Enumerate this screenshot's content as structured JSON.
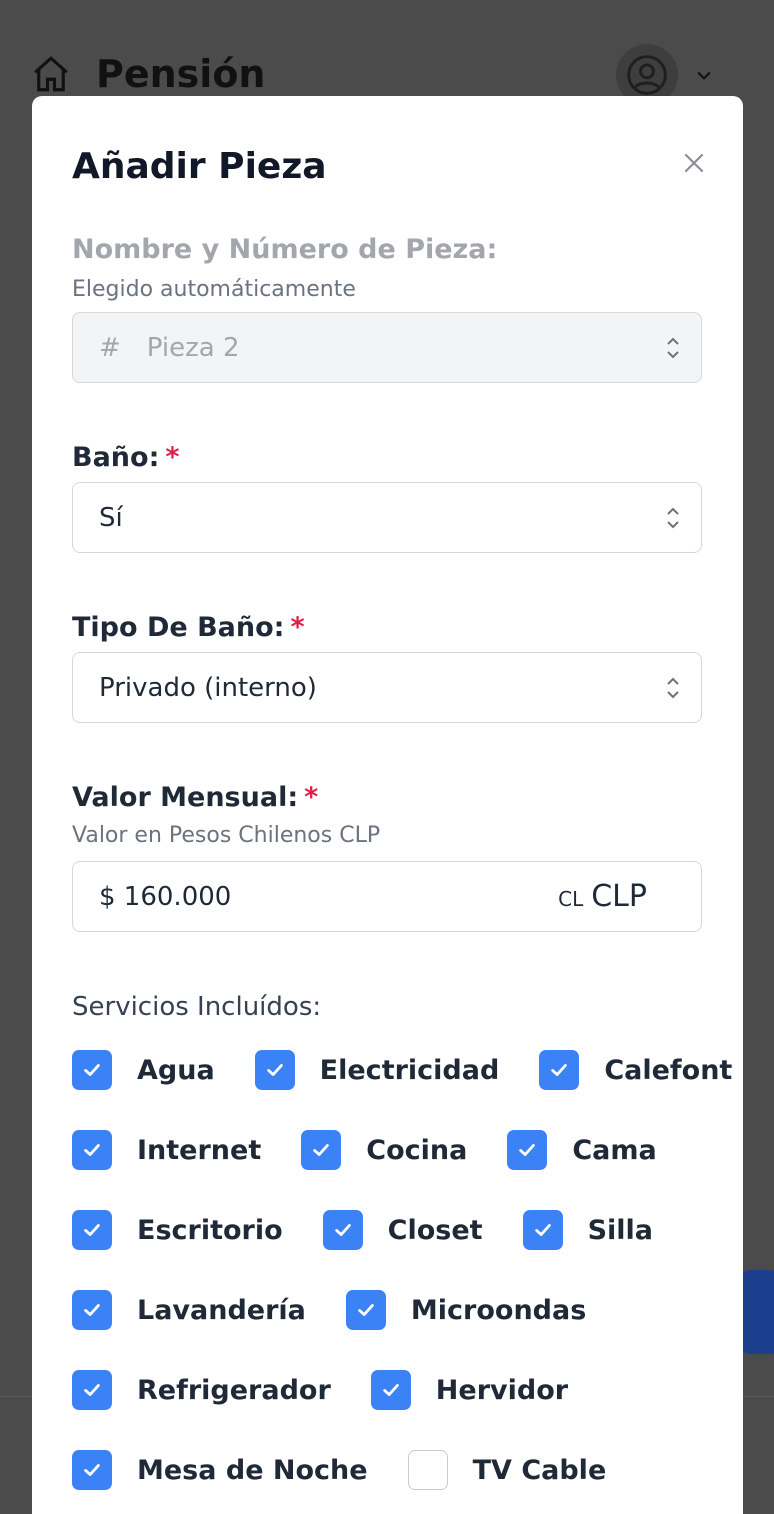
{
  "background": {
    "title": "Pensión",
    "icons": {
      "home": "home-icon",
      "user": "user-circle-icon",
      "menu": "chevron-down-icon"
    }
  },
  "modal": {
    "title": "Añadir Pieza",
    "close_icon": "close-icon",
    "room_name": {
      "label": "Nombre y Número de Pieza:",
      "help": "Elegido automáticamente",
      "prefix": "#",
      "value": "Pieza 2"
    },
    "bathroom": {
      "label": "Baño:",
      "required": "*",
      "value": "Sí"
    },
    "bathroom_type": {
      "label": "Tipo De Baño:",
      "required": "*",
      "value": "Privado (interno)"
    },
    "monthly_value": {
      "label": "Valor Mensual:",
      "required": "*",
      "help": "Valor en Pesos Chilenos CLP",
      "value": "$ 160.000",
      "flag": "CL",
      "currency": "CLP"
    },
    "services": {
      "label": "Servicios Incluídos:",
      "rows": [
        [
          {
            "label": "Agua",
            "checked": true
          },
          {
            "label": "Electricidad",
            "checked": true
          },
          {
            "label": "Calefont",
            "checked": true
          }
        ],
        [
          {
            "label": "Internet",
            "checked": true
          },
          {
            "label": "Cocina",
            "checked": true
          },
          {
            "label": "Cama",
            "checked": true
          }
        ],
        [
          {
            "label": "Escritorio",
            "checked": true
          },
          {
            "label": "Closet",
            "checked": true
          },
          {
            "label": "Silla",
            "checked": true
          }
        ],
        [
          {
            "label": "Lavandería",
            "checked": true
          },
          {
            "label": "Microondas",
            "checked": true
          }
        ],
        [
          {
            "label": "Refrigerador",
            "checked": true
          },
          {
            "label": "Hervidor",
            "checked": true
          }
        ],
        [
          {
            "label": "Mesa de Noche",
            "checked": true
          },
          {
            "label": "TV Cable",
            "checked": false
          }
        ]
      ]
    }
  },
  "colors": {
    "accent": "#3b82f6",
    "required": "#e11d48",
    "overlay": "#4b4b4b"
  }
}
